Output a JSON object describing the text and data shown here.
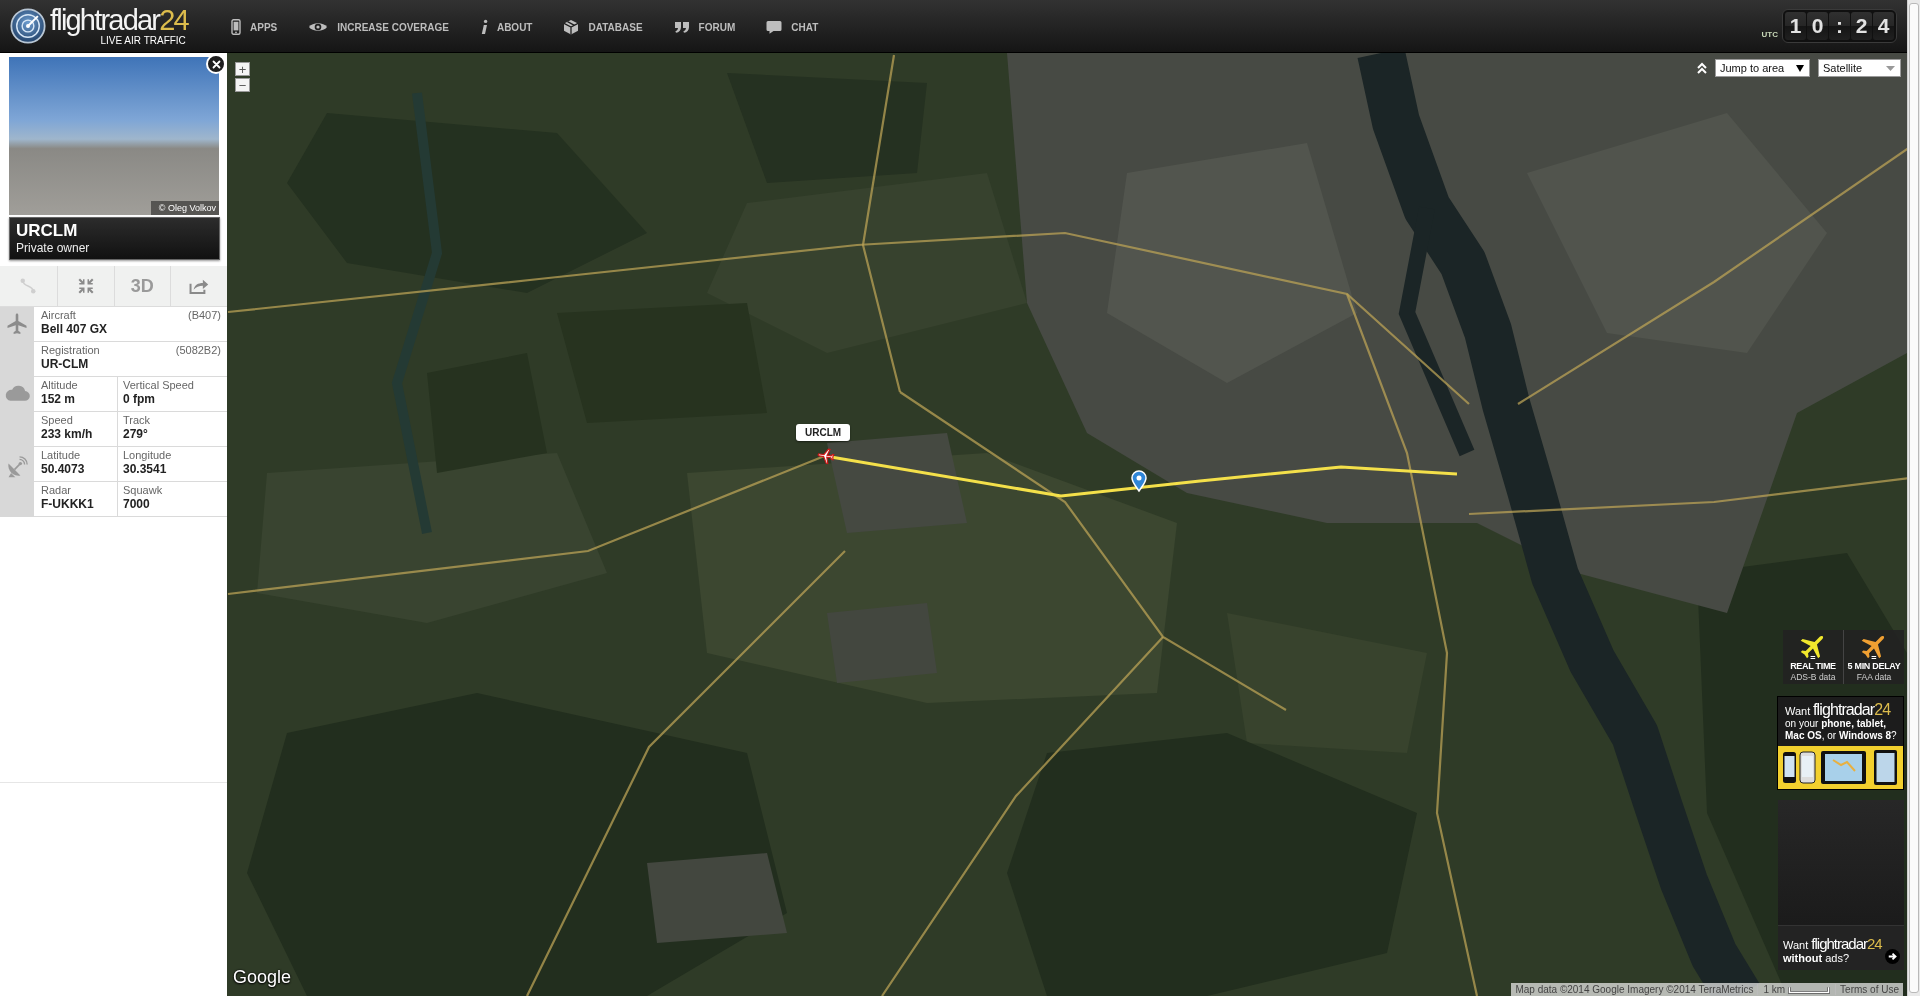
{
  "header": {
    "wordmark": "flightradar",
    "wordmark_accent": "24",
    "tagline": "LIVE AIR TRAFFIC",
    "nav": [
      {
        "label": "APPS"
      },
      {
        "label": "INCREASE COVERAGE"
      },
      {
        "label": "ABOUT"
      },
      {
        "label": "DATABASE"
      },
      {
        "label": "FORUM"
      },
      {
        "label": "CHAT"
      }
    ],
    "clock": {
      "zone": "UTC",
      "digits": [
        "1",
        "0",
        ":",
        "2",
        "4"
      ]
    }
  },
  "aircraft_panel": {
    "photo_credit": "© Oleg Volkov",
    "callsign": "URCLM",
    "operator": "Private owner",
    "tools": [
      {
        "kind": "icon",
        "disabled": true
      },
      {
        "kind": "icon",
        "disabled": false
      },
      {
        "kind": "text",
        "label": "3D",
        "disabled": false
      },
      {
        "kind": "icon",
        "disabled": false
      }
    ],
    "sections": [
      {
        "rows": [
          {
            "cells": [
              {
                "label": "Aircraft",
                "value": "Bell 407 GX",
                "code": "(B407)"
              }
            ]
          },
          {
            "cells": [
              {
                "label": "Registration",
                "value": "UR-CLM",
                "code": "(5082B2)"
              }
            ]
          }
        ]
      },
      {
        "rows": [
          {
            "cells": [
              {
                "label": "Altitude",
                "value": "152 m"
              },
              {
                "label": "Vertical Speed",
                "value": "0 fpm"
              }
            ]
          },
          {
            "cells": [
              {
                "label": "Speed",
                "value": "233 km/h"
              },
              {
                "label": "Track",
                "value": "279°"
              }
            ]
          }
        ]
      },
      {
        "rows": [
          {
            "cells": [
              {
                "label": "Latitude",
                "value": "50.4073"
              },
              {
                "label": "Longitude",
                "value": "30.3541"
              }
            ]
          },
          {
            "cells": [
              {
                "label": "Radar",
                "value": "F-UKKK1"
              },
              {
                "label": "Squawk",
                "value": "7000"
              }
            ]
          }
        ]
      }
    ]
  },
  "map": {
    "zoom_buttons": [
      "+",
      "−"
    ],
    "area_select": "Jump to area",
    "type_select": "Satellite",
    "flight_label": "URCLM",
    "google_logo": "Google",
    "attribution": "Map data ©2014 Google Imagery ©2014 TerraMetrics",
    "scale": "1 km",
    "terms": "Terms of Use"
  },
  "promo": {
    "feeds": [
      {
        "sign": "=",
        "title": "REAL TIME",
        "subtitle": "ADS-B data",
        "color": "#f2e82c"
      },
      {
        "sign": "=",
        "title": "5 MIN DELAY",
        "subtitle": "FAA data",
        "color": "#f0a032"
      }
    ],
    "apps": {
      "lead": "Want",
      "wordmark": "flightradar",
      "wordmark_accent": "24",
      "text": "on your **phone, tablet,** **Mac OS**, or **Windows 8**?"
    },
    "ad_free": {
      "lead": "Want",
      "wordmark": "flightradar",
      "wordmark_accent": "24",
      "text": "**without** ads?"
    }
  }
}
